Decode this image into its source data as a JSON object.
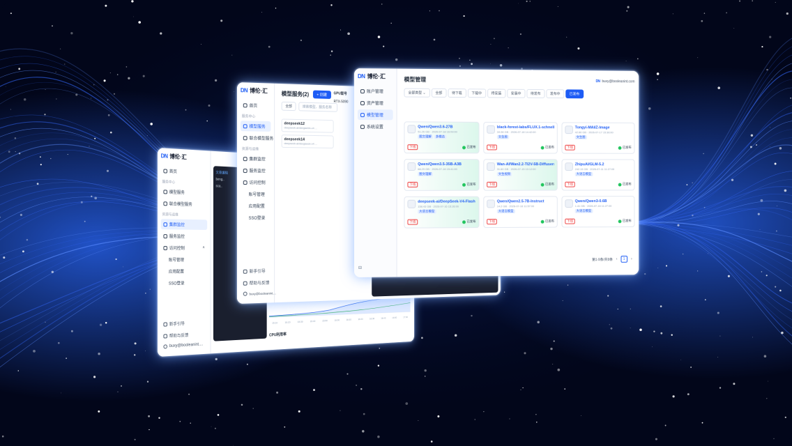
{
  "brand": {
    "name": "博伦·汇",
    "mark": "DN"
  },
  "win_a": {
    "nav": {
      "home": "首页",
      "group_service": "服务中心",
      "model_service": "模型服务",
      "joint_service": "联合模型服务",
      "group_resource": "资源与运维",
      "cluster_monitor": "集群监控",
      "service_monitor": "服务监控",
      "access_control": "访问控制",
      "account_mgmt": "账号管理",
      "app_config": "应用配置",
      "sso_login": "SSO登录"
    },
    "footer": {
      "guide": "新手引导",
      "help": "帮助与反馈",
      "user": "buxy@booleanint...."
    },
    "chart_label": "CPU利用率",
    "time_ticks": [
      "15:10",
      "15:20",
      "15:30",
      "15:40",
      "15:50",
      "16:00",
      "16:10",
      "16:20",
      "16:30",
      "16:40",
      "16:50",
      "17:00"
    ],
    "dark_list": [
      "文章编辑",
      "beng..",
      "sca.."
    ]
  },
  "win_b": {
    "nav": {
      "home": "首页",
      "group_service": "服务中心",
      "model_service": "模型服务",
      "joint_service": "联合模型服务",
      "group_resource": "资源与运维",
      "cluster_monitor": "集群监控",
      "service_monitor": "服务监控",
      "access_control": "访问控制",
      "account_mgmt": "账号管理",
      "app_config": "应用配置",
      "sso_login": "SSO登录"
    },
    "title": "模型服务(2)",
    "create_btn": "+ 创建",
    "filter_all": "全部",
    "search_placeholder": "搜索模型、服务名称",
    "gpu_label": "GPU型号",
    "gpu_value": "RTX-5090",
    "rows": [
      {
        "name": "deepseek12",
        "desc": "deepseek-ai/deepseek-v4 ..."
      },
      {
        "name": "deepseek14",
        "desc": "deepseek-ai/deepseek-v4 ..."
      }
    ],
    "footer": {
      "guide": "新手引导",
      "help": "帮助与反馈",
      "user": "buxy@booleanint...."
    }
  },
  "win_c": {
    "nav": {
      "account": "账户管理",
      "asset": "资产管理",
      "model_mgmt": "模型管理",
      "system": "系统设置"
    },
    "title": "模型管理",
    "user": "buxy@booleanint.com",
    "type_select": "全部类型",
    "filters": [
      "全部",
      "待下载",
      "下载中",
      "待安装",
      "安装中",
      "待发布",
      "发布中",
      "已发布"
    ],
    "search_placeholder": "模型名称",
    "add_btn": "+ 添加模型",
    "cards": [
      {
        "name": "Qwen/Qwen3.6-27B",
        "meta": "51.26 GB · 2026-07-18 16:09:00",
        "tags": [
          "图文理解",
          "多模态"
        ],
        "status": "已发布",
        "off": "下线",
        "mint": true
      },
      {
        "name": "black-forest-labs/FLUX.1-schnell",
        "meta": "34.08 GB · 2026-07-18 14:42:00",
        "tags": [
          "文生图"
        ],
        "status": "已发布",
        "off": "下线",
        "mint": false
      },
      {
        "name": "Tongyi-MAI/Z-Image",
        "meta": "42.66 GB · 2026-07-17 15:36:00",
        "tags": [
          "文生图"
        ],
        "status": "已发布",
        "off": "下线",
        "mint": false
      },
      {
        "name": "Qwen/Qwen3.5-35B-A3B",
        "meta": "68.29 GB · 2026-07-16 15:41:00",
        "tags": [
          "图文理解"
        ],
        "status": "已发布",
        "off": "下线",
        "mint": true
      },
      {
        "name": "Wan-AI/Wan2.2-TI2V-5B-Diffusers",
        "meta": "31.60 GB · 2026-07-15 10:12:00",
        "tags": [
          "文生视频"
        ],
        "status": "已发布",
        "off": "下线",
        "mint": true
      },
      {
        "name": "ZhipuAI/GLM-5.2",
        "meta": "242.15 GB · 2026-07-11 11:27:00",
        "tags": [
          "大语言模型"
        ],
        "status": "已发布",
        "off": "下线",
        "mint": false
      },
      {
        "name": "deepseek-ai/DeepSeek-V4-Flash",
        "meta": "158.43 GB · 2026-07-16 15:26:00",
        "tags": [
          "大语言模型"
        ],
        "status": "已发布",
        "off": "下线",
        "mint": true
      },
      {
        "name": "Qwen/Qwen2.5-7B-Instruct",
        "meta": "14.2 GB · 2026-07-16 11:57:00",
        "tags": [
          "大语言模型"
        ],
        "status": "已发布",
        "off": "下线",
        "mint": false
      },
      {
        "name": "Qwen/Qwen3-0.6B",
        "meta": "1.41 GB · 2026-07-16 11:27:00",
        "tags": [
          "大语言模型"
        ],
        "status": "已发布",
        "off": "下线",
        "mint": false
      }
    ],
    "pagination": {
      "summary": "第1-9条/共9条",
      "page": "1",
      "prev": "‹",
      "next": "›"
    }
  }
}
